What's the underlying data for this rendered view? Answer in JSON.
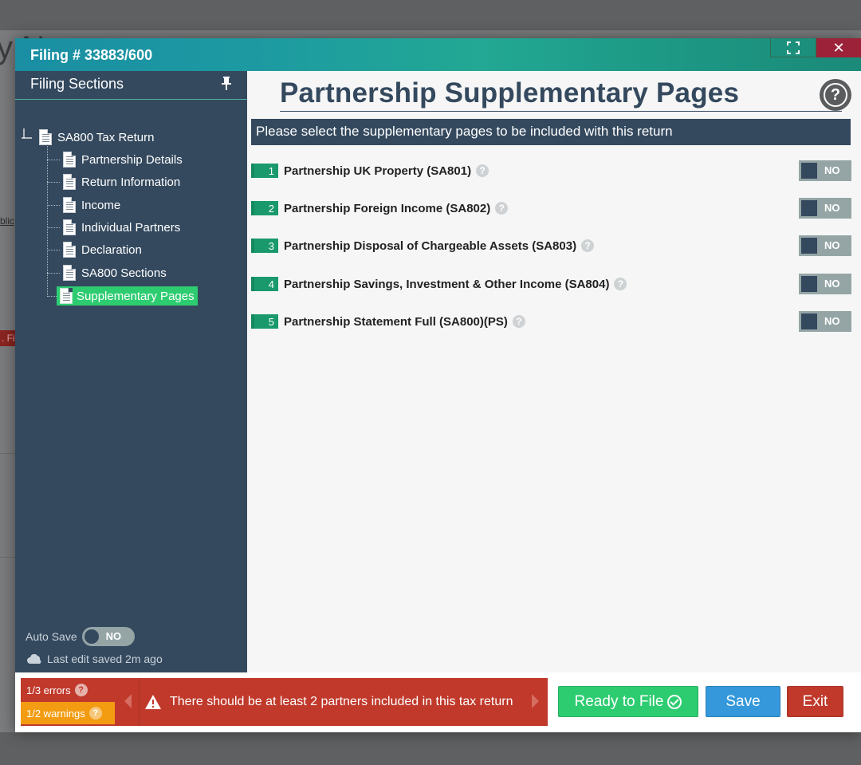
{
  "modal": {
    "title": "Filing # 33883/600",
    "close_label": "✕"
  },
  "sidebar": {
    "title": "Filing Sections",
    "collapse_label": "»",
    "tree": {
      "root": "SA800 Tax Return",
      "items": [
        {
          "label": "Partnership Details",
          "active": false
        },
        {
          "label": "Return Information",
          "active": false
        },
        {
          "label": "Income",
          "active": false
        },
        {
          "label": "Individual Partners",
          "active": false
        },
        {
          "label": "Declaration",
          "active": false
        },
        {
          "label": "SA800 Sections",
          "active": false
        },
        {
          "label": "Supplementary Pages",
          "active": true
        }
      ]
    },
    "autosave": {
      "label": "Auto Save",
      "state": "NO"
    },
    "last_saved": "Last edit saved 2m ago"
  },
  "content": {
    "title": "Partnership Supplementary Pages",
    "help_label": "?",
    "instruction": "Please select the supplementary pages to be included with this return",
    "pages": [
      {
        "num": "1",
        "label": "Partnership UK Property (SA801)",
        "toggle": "NO"
      },
      {
        "num": "2",
        "label": "Partnership Foreign Income (SA802)",
        "toggle": "NO"
      },
      {
        "num": "3",
        "label": "Partnership Disposal of Chargeable Assets (SA803)",
        "toggle": "NO"
      },
      {
        "num": "4",
        "label": "Partnership Savings, Investment & Other Income (SA804)",
        "toggle": "NO"
      },
      {
        "num": "5",
        "label": "Partnership Statement Full (SA800)(PS)",
        "toggle": "NO"
      }
    ]
  },
  "footer": {
    "errors": "1/3 errors",
    "warnings": "1/2 warnings",
    "message": "There should be at least 2 partners included in this tax return",
    "ready_label": "Ready to File",
    "save_label": "Save",
    "exit_label": "Exit"
  },
  "background": {
    "title_fragment": "y N",
    "link_fragment": "blic",
    "badge_fragment": ". Fi"
  },
  "colors": {
    "header_start": "#1a8ea3",
    "header_end": "#1b8a78",
    "sidebar": "#34495e",
    "active_item": "#2ecc71",
    "badge": "#1a9a6c",
    "error": "#c0392b",
    "warning": "#f39c12",
    "ready": "#2ecc71",
    "save": "#3498db",
    "exit": "#c0392b",
    "close": "#9b2238"
  }
}
